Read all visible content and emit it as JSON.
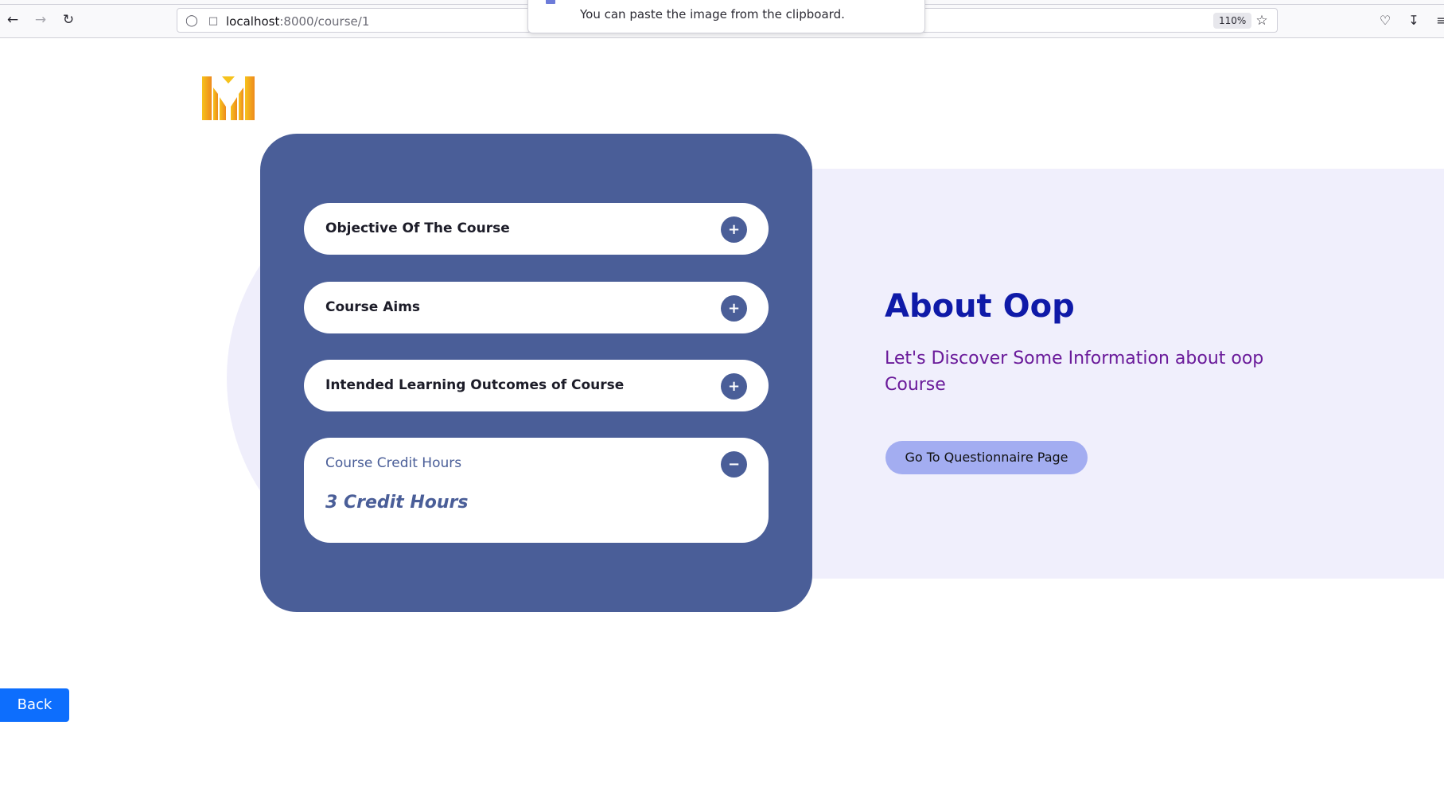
{
  "browser": {
    "back_icon": "arrow-left-icon",
    "forward_icon": "arrow-right-icon",
    "reload_icon": "reload-icon",
    "url_host": "localhost",
    "url_path": ":8000/course/1",
    "zoom": "110%",
    "popup_message": "You can paste the image from the clipboard."
  },
  "logo": {
    "icon": "logo-icon"
  },
  "accordion": {
    "items": [
      {
        "title": "Objective Of The Course",
        "toggle": "+"
      },
      {
        "title": "Course Aims",
        "toggle": "+"
      },
      {
        "title": "Intended Learning Outcomes of Course",
        "toggle": "+"
      },
      {
        "title": "Course Credit Hours",
        "toggle": "−",
        "body": "3 Credit Hours"
      }
    ]
  },
  "about": {
    "title": "About Oop",
    "subtitle": "Let's Discover Some Information about oop Course",
    "button_label": "Go To Questionnaire Page"
  },
  "back_label": "Back",
  "colors": {
    "panel": "#4a5e98",
    "band": "#f0effc",
    "title": "#0f1aa8",
    "subtitle": "#6a1a9a",
    "go_button": "#a3adf1",
    "back_button": "#0d6efd"
  }
}
